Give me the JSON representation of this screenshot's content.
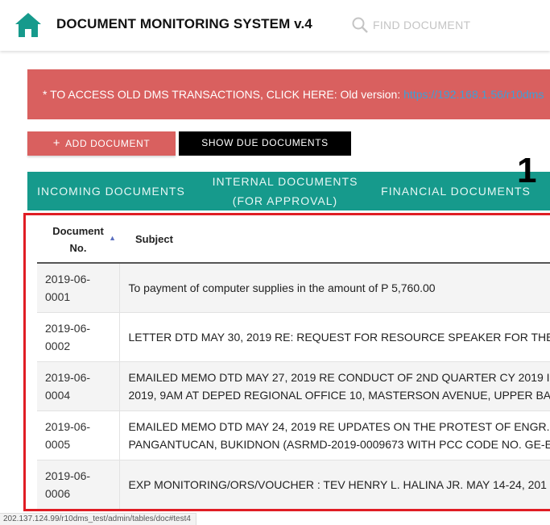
{
  "header": {
    "title": "DOCUMENT MONITORING SYSTEM v.4",
    "search_placeholder": "FIND DOCUMENT"
  },
  "alert": {
    "text": "* TO ACCESS OLD DMS TRANSACTIONS, CLICK HERE: Old version: ",
    "link": "https://192.168.1.56/r10dms"
  },
  "actions": {
    "add_label": "ADD DOCUMENT",
    "due_label": "SHOW DUE DOCUMENTS"
  },
  "tabs": [
    {
      "label": "INCOMING DOCUMENTS"
    },
    {
      "label_line1": "INTERNAL DOCUMENTS",
      "label_line2": "(FOR APPROVAL)"
    },
    {
      "label": "FINANCIAL DOCUMENTS"
    }
  ],
  "annotation_number": "1",
  "table": {
    "headers": {
      "doc_no_line1": "Document",
      "doc_no_line2": "No.",
      "subject": "Subject"
    },
    "rows": [
      {
        "no1": "2019-06-",
        "no2": "0001",
        "subject1": "To payment of computer supplies in the amount of P 5,760.00",
        "subject2": ""
      },
      {
        "no1": "2019-06-",
        "no2": "0002",
        "subject1": "LETTER DTD MAY 30, 2019 RE: REQUEST FOR RESOURCE SPEAKER FOR THE C",
        "subject2": ""
      },
      {
        "no1": "2019-06-",
        "no2": "0004",
        "subject1": "EMAILED MEMO DTD MAY 27, 2019 RE CONDUCT OF 2ND QUARTER CY 2019 I",
        "subject2": "2019, 9AM AT DEPED REGIONAL OFFICE 10, MASTERSON AVENUE, UPPER BA"
      },
      {
        "no1": "2019-06-",
        "no2": "0005",
        "subject1": "EMAILED MEMO DTD MAY 24, 2019 RE UPDATES ON THE PROTEST OF ENGR.",
        "subject2": "PANGANTUCAN, BUKIDNON (ASRMD-2019-0009673 WITH PCC CODE NO. GE-E"
      },
      {
        "no1": "2019-06-",
        "no2": "0006",
        "subject1": "EXP MONITORING/ORS/VOUCHER : TEV HENRY L. HALINA JR. MAY 14-24, 201",
        "subject2": ""
      }
    ]
  },
  "status_bar": "202.137.124.99/r10dms_test/admin/tables/doc#test4",
  "colors": {
    "teal": "#169a8c",
    "red": "#d9605f",
    "highlight": "#e01d24"
  }
}
